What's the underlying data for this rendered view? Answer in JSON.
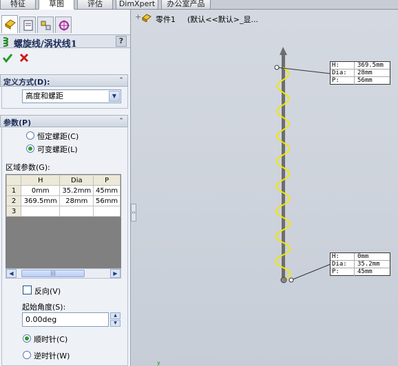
{
  "tabs": [
    "特征",
    "草图",
    "评估",
    "DimXpert",
    "办公室产品"
  ],
  "active_tab": 1,
  "tree": {
    "part_label": "零件1",
    "config_label": "(默认<<默认>_显..."
  },
  "panel": {
    "title": "螺旋线/涡状线1",
    "help": "?",
    "definition_group": {
      "header": "定义方式(D):",
      "selected": "高度和螺距"
    },
    "params_group": {
      "header": "参数(P)",
      "pitch_constant": "恒定螺距(C)",
      "pitch_variable": "可变螺距(L)",
      "pitch_mode": "variable",
      "region_label": "区域参数(G):",
      "columns": [
        "",
        "H",
        "Dia",
        "P"
      ],
      "rows": [
        [
          "1",
          "0mm",
          "35.2mm",
          "45mm"
        ],
        [
          "2",
          "369.5mm",
          "28mm",
          "56mm"
        ],
        [
          "3",
          "",
          "",
          ""
        ]
      ],
      "reverse_label": "反向(V)",
      "reverse_checked": false,
      "start_angle_label": "起始角度(S):",
      "start_angle_value": "0.00deg",
      "clockwise": "顺时针(C)",
      "counterclockwise": "逆时针(W)",
      "direction": "clockwise"
    }
  },
  "viewport": {
    "helix_color": "#f0e800",
    "top_callout": {
      "H": "369.5mm",
      "Dia": "28mm",
      "P": "56mm"
    },
    "bottom_callout": {
      "H": "0mm",
      "Dia": "35.2mm",
      "P": "45mm"
    },
    "axis_label": "y"
  },
  "icons": {
    "ok": "check-icon",
    "cancel": "x-icon"
  }
}
